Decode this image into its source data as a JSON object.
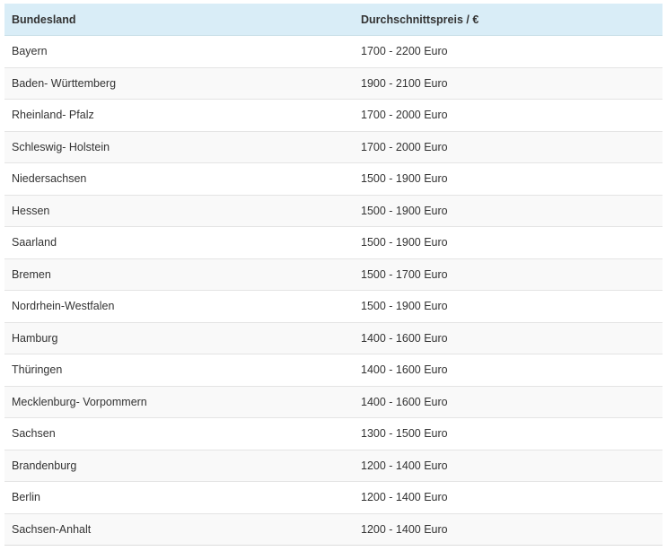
{
  "table": {
    "headers": [
      "Bundesland",
      "Durchschnittspreis / €"
    ],
    "rows": [
      [
        "Bayern",
        "1700 - 2200 Euro"
      ],
      [
        "Baden- Württemberg",
        "1900 - 2100 Euro"
      ],
      [
        "Rheinland- Pfalz",
        "1700 - 2000 Euro"
      ],
      [
        "Schleswig- Holstein",
        "1700 - 2000 Euro"
      ],
      [
        "Niedersachsen",
        "1500 - 1900 Euro"
      ],
      [
        "Hessen",
        "1500 - 1900 Euro"
      ],
      [
        "Saarland",
        "1500 - 1900 Euro"
      ],
      [
        "Bremen",
        "1500 - 1700 Euro"
      ],
      [
        "Nordrhein-Westfalen",
        "1500 - 1900 Euro"
      ],
      [
        "Hamburg",
        "1400 - 1600 Euro"
      ],
      [
        "Thüringen",
        "1400 - 1600 Euro"
      ],
      [
        "Mecklenburg- Vorpommern",
        "1400 - 1600 Euro"
      ],
      [
        "Sachsen",
        "1300 - 1500 Euro"
      ],
      [
        "Brandenburg",
        "1200 - 1400 Euro"
      ],
      [
        "Berlin",
        "1200 - 1400 Euro"
      ],
      [
        "Sachsen-Anhalt",
        "1200 - 1400 Euro"
      ]
    ]
  },
  "colors": {
    "header_background": "#d9edf7",
    "row_stripe": "#f9f9f9",
    "text": "#333333",
    "row_border": "#e4e4e4"
  }
}
